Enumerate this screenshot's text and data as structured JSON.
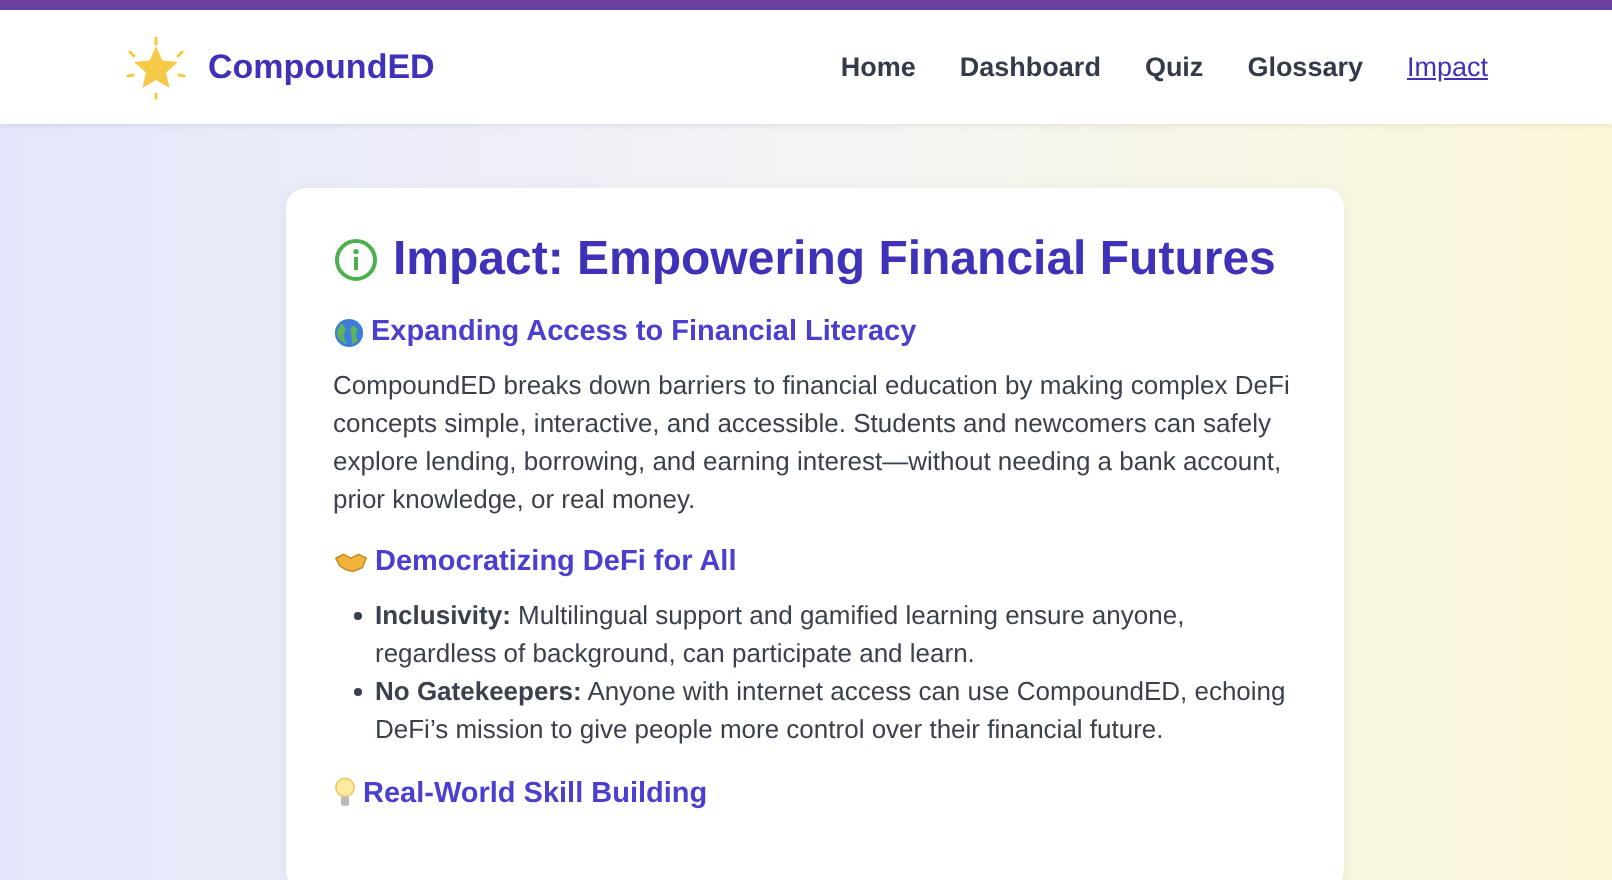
{
  "header": {
    "brand": "CompoundED",
    "nav": [
      {
        "label": "Home",
        "selected": false
      },
      {
        "label": "Dashboard",
        "selected": false
      },
      {
        "label": "Quiz",
        "selected": false
      },
      {
        "label": "Glossary",
        "selected": false
      },
      {
        "label": "Impact",
        "selected": true
      }
    ]
  },
  "card": {
    "title": "Impact: Empowering Financial Futures",
    "sections": [
      {
        "kind": "paragraph",
        "heading": "Expanding Access to Financial Literacy",
        "text": "CompoundED breaks down barriers to financial education by making complex DeFi concepts simple, interactive, and accessible. Students and newcomers can safely explore lending, borrowing, and earning interest—without needing a bank account, prior knowledge, or real money."
      },
      {
        "kind": "list",
        "heading": "Democratizing DeFi for All",
        "items": [
          "**Inclusivity:** Multilingual support and gamified learning ensure anyone, regardless of background, can participate and learn.",
          "**No Gatekeepers:** Anyone with internet access can use CompoundED, echoing DeFi’s mission to give people more control over their financial future."
        ]
      },
      {
        "kind": "heading",
        "heading": "Real-World Skill Building"
      }
    ]
  }
}
